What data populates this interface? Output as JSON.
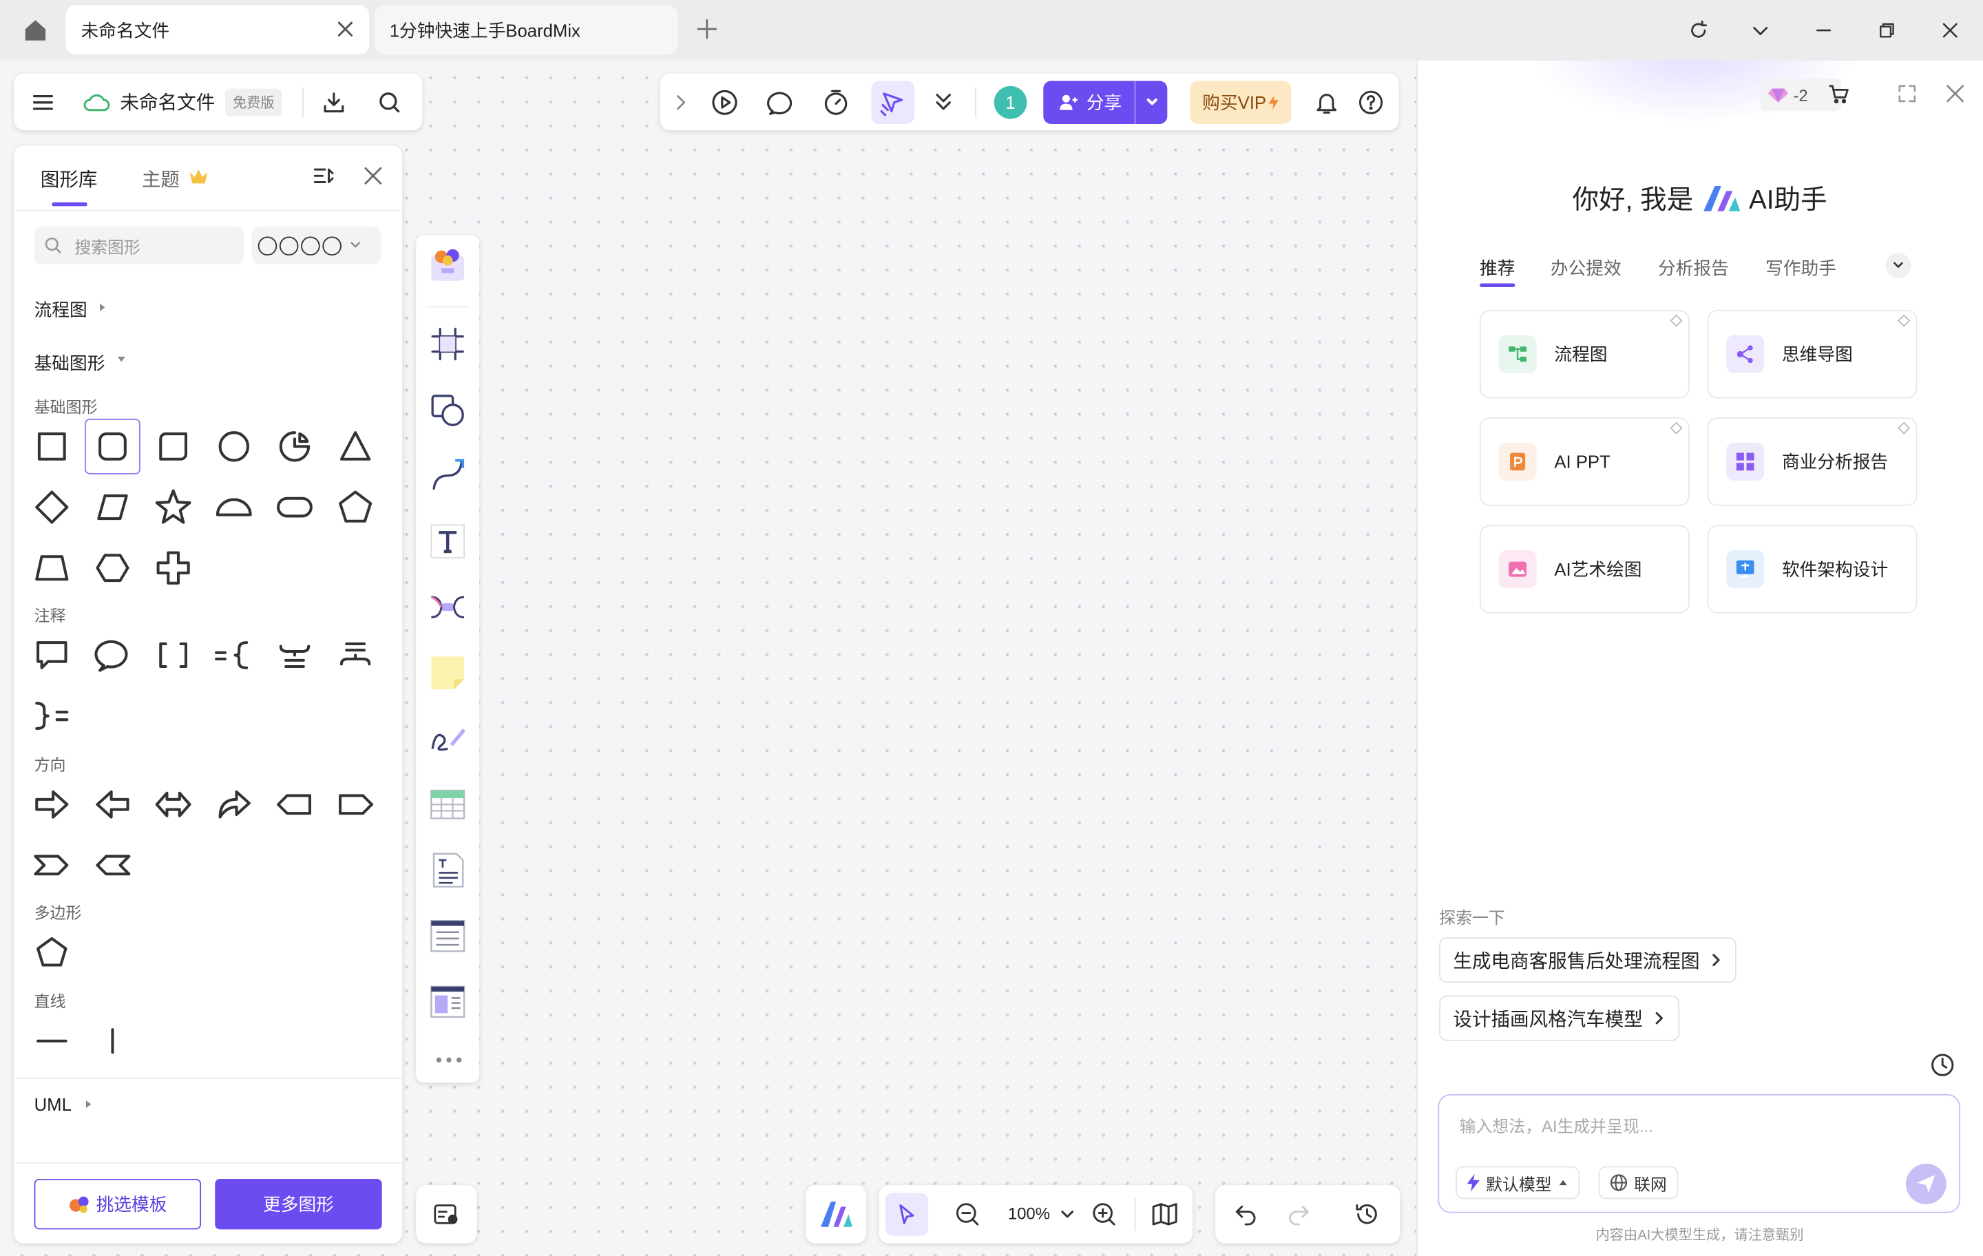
{
  "tabs": [
    {
      "label": "未命名文件",
      "active": true
    },
    {
      "label": "1分钟快速上手BoardMix",
      "active": false
    }
  ],
  "topbar": {
    "filename": "未命名文件",
    "plan_badge": "免费版"
  },
  "shape_panel": {
    "tab_library": "图形库",
    "tab_theme": "主题",
    "search_placeholder": "搜索图形",
    "sections": {
      "flowchart": "流程图",
      "basic": "基础图形",
      "basic_label": "基础图形",
      "note": "注释",
      "direction": "方向",
      "polygon": "多边形",
      "line": "直线",
      "uml": "UML"
    },
    "btn_template": "挑选模板",
    "btn_more": "更多图形"
  },
  "actionbar": {
    "user_count": "1",
    "share": "分享",
    "vip": "购买VIP"
  },
  "bottom": {
    "zoom": "100%"
  },
  "ai": {
    "credits": "-2",
    "greeting_pre": "你好, 我是",
    "greeting_post": "AI助手",
    "tabs": [
      "推荐",
      "办公提效",
      "分析报告",
      "写作助手"
    ],
    "features": [
      {
        "label": "流程图",
        "color": "#3fb56e",
        "bg": "#e8f6ee"
      },
      {
        "label": "思维导图",
        "color": "#8a5cf0",
        "bg": "#efe9fd"
      },
      {
        "label": "AI PPT",
        "color": "#f0883a",
        "bg": "#fdf0e6"
      },
      {
        "label": "商业分析报告",
        "color": "#8a5cf0",
        "bg": "#efe9fd"
      },
      {
        "label": "AI艺术绘图",
        "color": "#f06fb0",
        "bg": "#fde9f3"
      },
      {
        "label": "软件架构设计",
        "color": "#3b8ff0",
        "bg": "#e6f1fd"
      }
    ],
    "explore_label": "探索一下",
    "suggestions": [
      "生成电商客服售后处理流程图",
      "设计插画风格汽车模型"
    ],
    "input_placeholder": "输入想法，AI生成并呈现...",
    "model": "默认模型",
    "web": "联网",
    "disclaimer": "内容由AI大模型生成，请注意甄别"
  }
}
